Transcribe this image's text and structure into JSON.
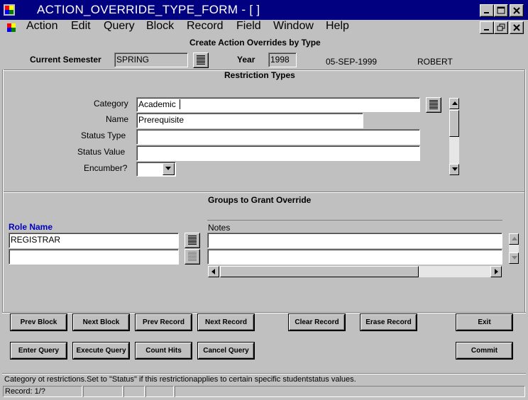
{
  "window": {
    "title": "ACTION_OVERRIDE_TYPE_FORM - [ ]"
  },
  "menu": [
    "Action",
    "Edit",
    "Query",
    "Block",
    "Record",
    "Field",
    "Window",
    "Help"
  ],
  "form": {
    "title": "Create Action Overrides by Type",
    "current_semester_label": "Current Semester",
    "current_semester_value": "SPRING",
    "year_label": "Year",
    "year_value": "1998",
    "date": "05-SEP-1999",
    "user": "ROBERT"
  },
  "restriction_types": {
    "heading": "Restriction Types",
    "category_label": "Category",
    "category_value": "Academic",
    "name_label": "Name",
    "name_value": "Prerequisite",
    "status_type_label": "Status Type",
    "status_type_value": "",
    "status_value_label": "Status Value",
    "status_value_value": "",
    "encumber_label": "Encumber?",
    "encumber_value": ""
  },
  "groups": {
    "heading": "Groups to Grant Override",
    "role_name_label": "Role Name",
    "notes_label": "Notes",
    "rows": [
      {
        "role": "REGISTRAR",
        "notes": ""
      },
      {
        "role": "",
        "notes": ""
      }
    ]
  },
  "buttons": {
    "prev_block": "Prev Block",
    "next_block": "Next Block",
    "prev_record": "Prev Record",
    "next_record": "Next Record",
    "clear_record": "Clear Record",
    "erase_record": "Erase Record",
    "exit": "Exit",
    "enter_query": "Enter Query",
    "execute_query": "Execute Query",
    "count_hits": "Count Hits",
    "cancel_query": "Cancel Query",
    "commit": "Commit"
  },
  "status": {
    "hint": "Category ot restrictions.Set to \"Status\" if this restrictionapplies to certain specific studentstatus values.",
    "record": "Record: 1/?"
  },
  "colors": {
    "titlebar": "#000080",
    "face": "#c0c0c0",
    "role_label": "#0000c0"
  }
}
